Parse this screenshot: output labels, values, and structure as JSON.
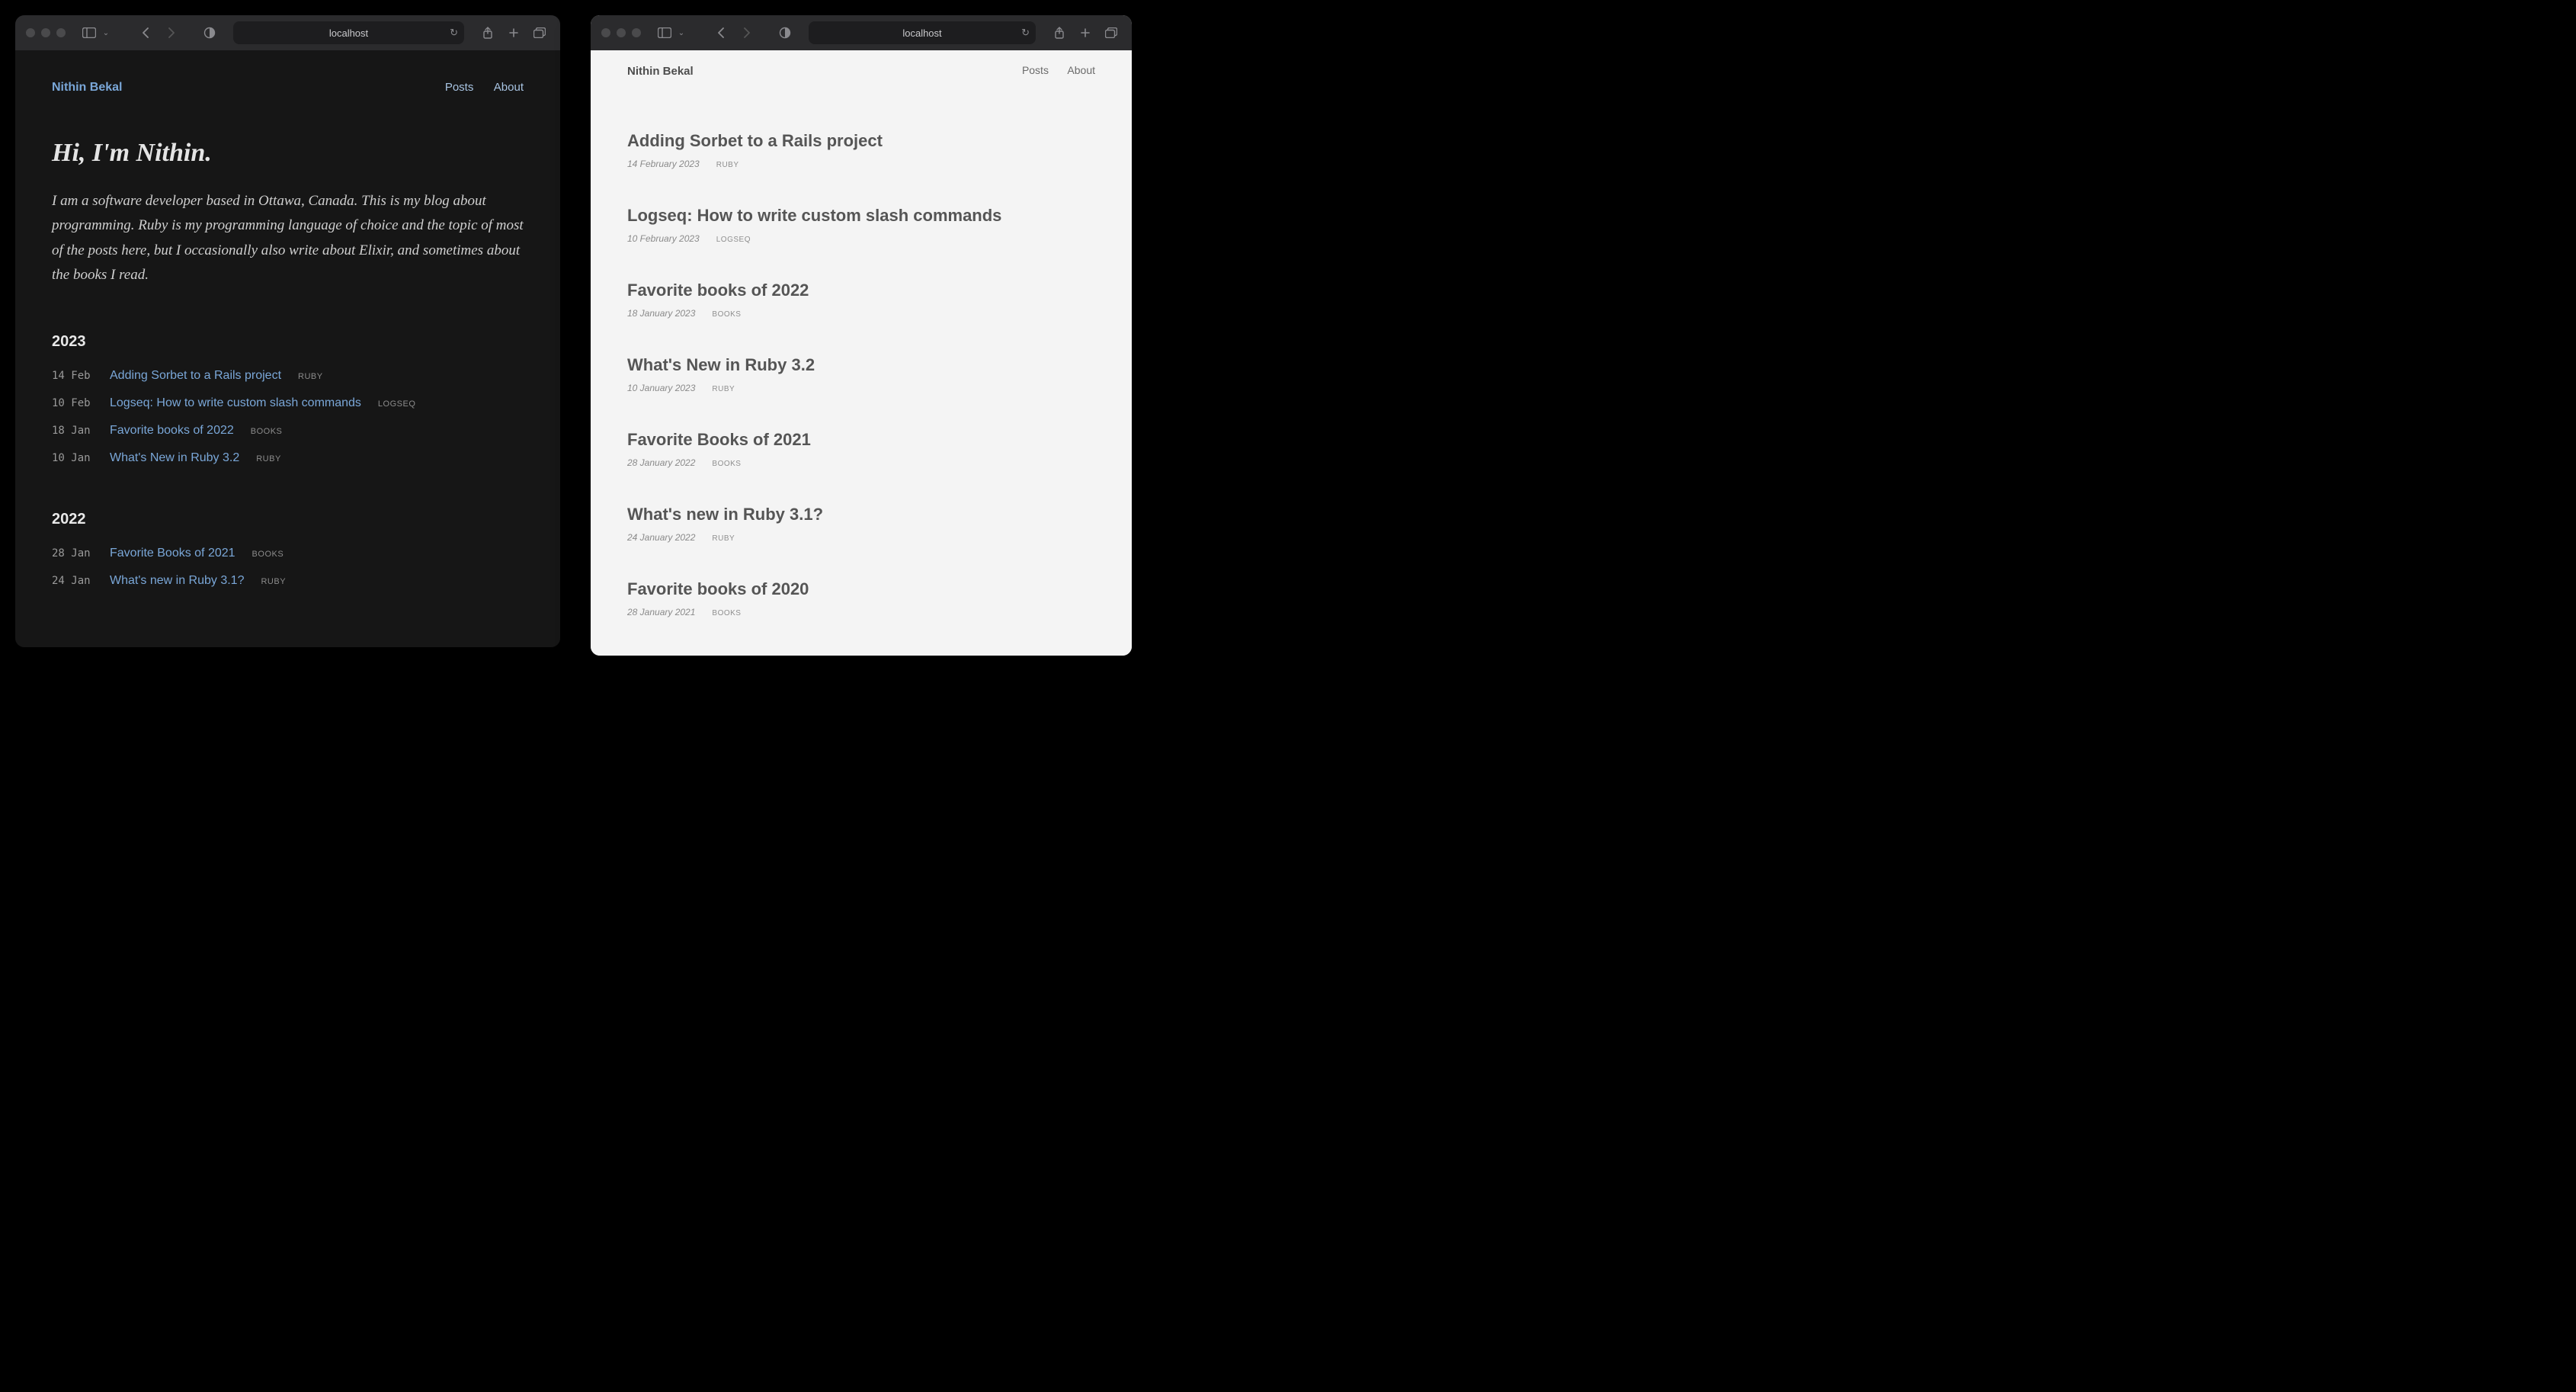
{
  "address": "localhost",
  "brand": "Nithin Bekal",
  "nav_links": {
    "posts": "Posts",
    "about": "About"
  },
  "dark": {
    "hero_heading": "Hi, I'm Nithin.",
    "hero_body": "I am a software developer based in Ottawa, Canada. This is my blog about programming. Ruby is my programming language of choice and the topic of most of the posts here, but I occasionally also write about Elixir, and sometimes about the books I read.",
    "years": {
      "y2023": "2023",
      "y2022": "2022"
    },
    "posts_2023": [
      {
        "date": "14 Feb",
        "title": "Adding Sorbet to a Rails project",
        "tag": "RUBY"
      },
      {
        "date": "10 Feb",
        "title": "Logseq: How to write custom slash commands",
        "tag": "LOGSEQ"
      },
      {
        "date": "18 Jan",
        "title": "Favorite books of 2022",
        "tag": "BOOKS"
      },
      {
        "date": "10 Jan",
        "title": "What's New in Ruby 3.2",
        "tag": "RUBY"
      }
    ],
    "posts_2022": [
      {
        "date": "28 Jan",
        "title": "Favorite Books of 2021",
        "tag": "BOOKS"
      },
      {
        "date": "24 Jan",
        "title": "What's new in Ruby 3.1?",
        "tag": "RUBY"
      }
    ]
  },
  "light": {
    "posts": [
      {
        "title": "Adding Sorbet to a Rails project",
        "date": "14 February 2023",
        "tag": "RUBY"
      },
      {
        "title": "Logseq: How to write custom slash commands",
        "date": "10 February 2023",
        "tag": "LOGSEQ"
      },
      {
        "title": "Favorite books of 2022",
        "date": "18 January 2023",
        "tag": "BOOKS"
      },
      {
        "title": "What's New in Ruby 3.2",
        "date": "10 January 2023",
        "tag": "RUBY"
      },
      {
        "title": "Favorite Books of 2021",
        "date": "28 January 2022",
        "tag": "BOOKS"
      },
      {
        "title": "What's new in Ruby 3.1?",
        "date": "24 January 2022",
        "tag": "RUBY"
      },
      {
        "title": "Favorite books of 2020",
        "date": "28 January 2021",
        "tag": "BOOKS"
      }
    ]
  }
}
